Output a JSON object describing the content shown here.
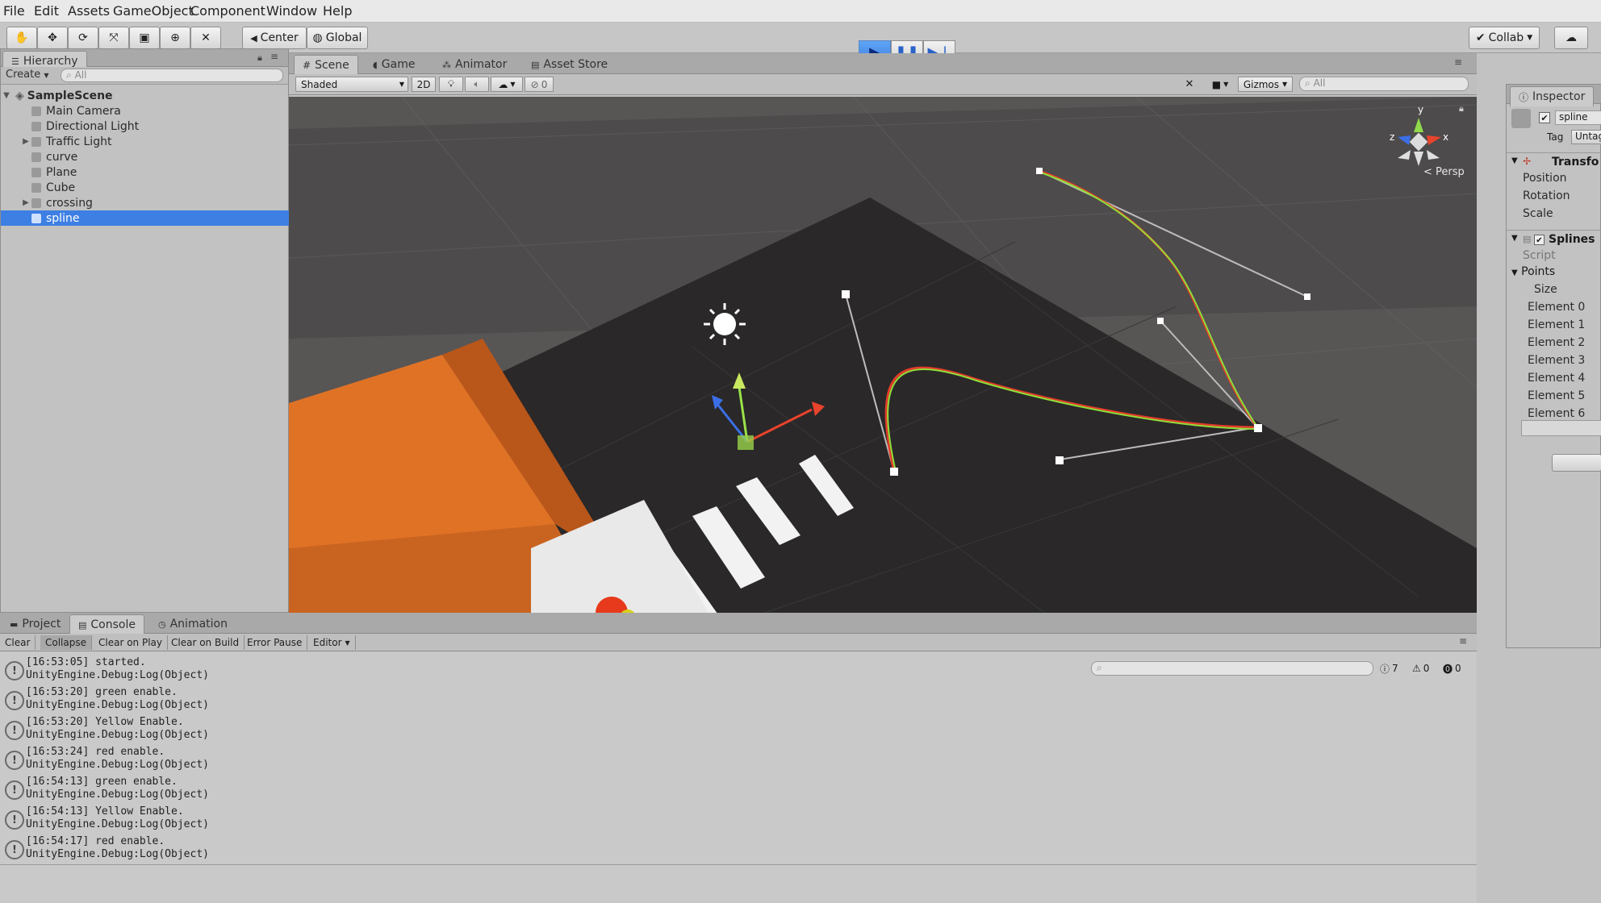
{
  "menu": [
    "File",
    "Edit",
    "Assets",
    "GameObject",
    "Component",
    "Window",
    "Help"
  ],
  "toolbar": {
    "pivot_label": "Center",
    "space_label": "Global",
    "collab_label": "Collab"
  },
  "hierarchy": {
    "tab_label": "Hierarchy",
    "create_label": "Create",
    "search_placeholder": "All",
    "scene_name": "SampleScene",
    "items": [
      {
        "label": "Main Camera",
        "expandable": false,
        "selected": false
      },
      {
        "label": "Directional Light",
        "expandable": false,
        "selected": false
      },
      {
        "label": "Traffic Light",
        "expandable": true,
        "selected": false
      },
      {
        "label": "curve",
        "expandable": false,
        "selected": false
      },
      {
        "label": "Plane",
        "expandable": false,
        "selected": false
      },
      {
        "label": "Cube",
        "expandable": false,
        "selected": false
      },
      {
        "label": "crossing",
        "expandable": true,
        "selected": false
      },
      {
        "label": "spline",
        "expandable": false,
        "selected": true
      }
    ]
  },
  "center_tabs": {
    "scene": "Scene",
    "game": "Game",
    "animator": "Animator",
    "asset_store": "Asset Store"
  },
  "scene_toolbar": {
    "shading_mode": "Shaded",
    "mode_2d": "2D",
    "hidden_count": "0",
    "gizmos_label": "Gizmos",
    "search_placeholder": "All",
    "projection_label": "Persp"
  },
  "inspector": {
    "tab_label": "Inspector",
    "object_name": "spline",
    "tag_label": "Tag",
    "tag_value": "Untag",
    "transform_title": "Transfo",
    "transform_fields": [
      "Position",
      "Rotation",
      "Scale"
    ],
    "component_title": "Splines",
    "script_label": "Script",
    "points_label": "Points",
    "size_label": "Size",
    "elements": [
      "Element 0",
      "Element 1",
      "Element 2",
      "Element 3",
      "Element 4",
      "Element 5",
      "Element 6"
    ]
  },
  "bottom_tabs": {
    "project": "Project",
    "console": "Console",
    "animation": "Animation"
  },
  "console_toolbar": {
    "clear": "Clear",
    "collapse": "Collapse",
    "clear_on_play": "Clear on Play",
    "clear_on_build": "Clear on Build",
    "error_pause": "Error Pause",
    "editor": "Editor",
    "log_count": "7",
    "warning_count": "0",
    "error_count": "0"
  },
  "console_logs": [
    {
      "message": "[16:53:05] started.",
      "source": "UnityEngine.Debug:Log(Object)"
    },
    {
      "message": "[16:53:20] green enable.",
      "source": "UnityEngine.Debug:Log(Object)"
    },
    {
      "message": "[16:53:20] Yellow Enable.",
      "source": "UnityEngine.Debug:Log(Object)"
    },
    {
      "message": "[16:53:24] red enable.",
      "source": "UnityEngine.Debug:Log(Object)"
    },
    {
      "message": "[16:54:13] green enable.",
      "source": "UnityEngine.Debug:Log(Object)"
    },
    {
      "message": "[16:54:13] Yellow Enable.",
      "source": "UnityEngine.Debug:Log(Object)"
    },
    {
      "message": "[16:54:17] red enable.",
      "source": "UnityEngine.Debug:Log(Object)"
    }
  ],
  "colors": {
    "selection": "#3d7fe3",
    "play_active": "#3f7fe0",
    "scene_background": "#4a4848",
    "road_dark": "#2a2828",
    "building_orange": "#e07226",
    "spline_red": "#e23b2a",
    "spline_green": "#8ede3a"
  },
  "icons": {
    "hand_tool": "hand-icon",
    "move_tool": "move-icon",
    "rotate_tool": "rotate-icon",
    "scale_tool": "scale-icon",
    "rect_tool": "rect-icon",
    "transform_tool": "transform-icon",
    "custom_tool": "custom-tool-icon",
    "play": "play-icon",
    "pause": "pause-icon",
    "step": "step-icon"
  }
}
